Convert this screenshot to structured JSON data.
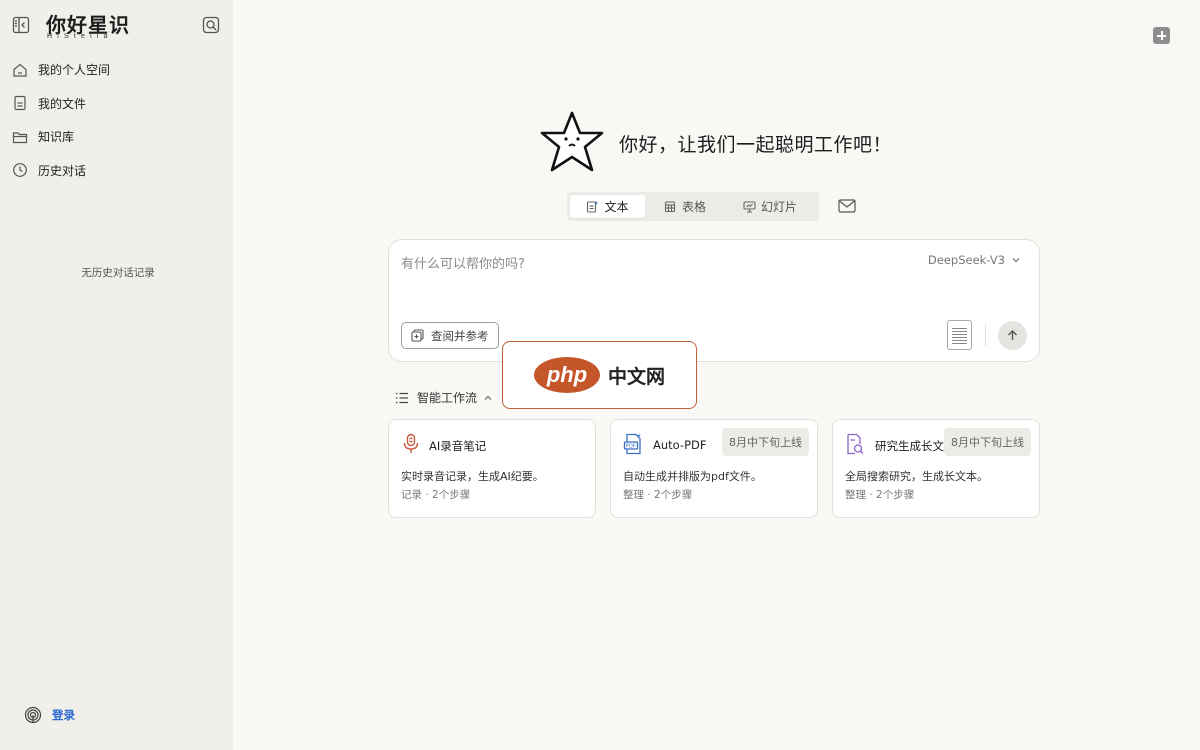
{
  "brand": {
    "title": "你好星识",
    "subtitle": "HiStella"
  },
  "sidebar": {
    "items": [
      {
        "label": "我的个人空间",
        "icon": "home-icon"
      },
      {
        "label": "我的文件",
        "icon": "file-icon"
      },
      {
        "label": "知识库",
        "icon": "folder-icon"
      },
      {
        "label": "历史对话",
        "icon": "clock-icon"
      }
    ],
    "empty_history": "无历史对话记录",
    "login_label": "登录"
  },
  "hero": {
    "greeting": "你好，让我们一起聪明工作吧！"
  },
  "modes": [
    {
      "label": "文本",
      "active": true
    },
    {
      "label": "表格",
      "active": false
    },
    {
      "label": "幻灯片",
      "active": false
    }
  ],
  "composer": {
    "placeholder": "有什么可以帮你的吗?",
    "model": "DeepSeek-V3",
    "reference_label": "查阅并参考"
  },
  "watermark": {
    "logo": "php",
    "text": "中文网"
  },
  "workflow": {
    "title": "智能工作流",
    "cards": [
      {
        "name": "AI录音笔记",
        "badge": "",
        "desc": "实时录音记录，生成AI纪要。",
        "meta": "记录 · 2个步骤",
        "icon": "microphone-icon"
      },
      {
        "name": "Auto-PDF",
        "badge": "8月中下旬上线",
        "desc": "自动生成并排版为pdf文件。",
        "meta": "整理 · 2个步骤",
        "icon": "pdf-icon"
      },
      {
        "name": "研究生成长文",
        "badge": "8月中下旬上线",
        "desc": "全局搜索研究，生成长文本。",
        "meta": "整理 · 2个步骤",
        "icon": "doc-search-icon"
      }
    ]
  },
  "colors": {
    "accent_orange": "#c5562a",
    "link_blue": "#2a6bd3",
    "sidebar_bg": "#f1efea",
    "main_bg": "#f9f8f5"
  }
}
